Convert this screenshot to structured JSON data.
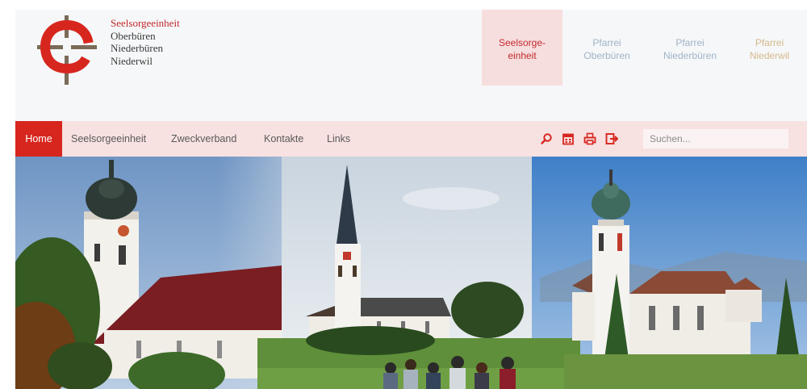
{
  "header": {
    "parish_name": [
      "Seelsorgeeinheit",
      "Oberbüren",
      "Niederbüren",
      "Niederwil"
    ],
    "tiles": [
      {
        "line1": "Seelsorge-",
        "line2": "einheit",
        "active": true
      },
      {
        "line1": "Pfarrei",
        "line2": "Oberbüren",
        "active": false
      },
      {
        "line1": "Pfarrei",
        "line2": "Niederbüren",
        "active": false
      },
      {
        "line1": "Pfarrei",
        "line2": "Niederwil",
        "active": false
      }
    ]
  },
  "nav": {
    "items": [
      "Home",
      "Seelsorgeeinheit",
      "Zweckverband",
      "Kontakte",
      "Links"
    ],
    "icons": [
      "search-icon",
      "calendar-icon",
      "print-icon",
      "login-icon"
    ],
    "search_placeholder": "Suchen..."
  },
  "colors": {
    "brand_red": "#d7261e",
    "nav_bg": "#f8e1e1",
    "tile_active_bg": "#f7dede",
    "tile_blue": "#9fb4c8",
    "tile_gold": "#d4b98c"
  }
}
